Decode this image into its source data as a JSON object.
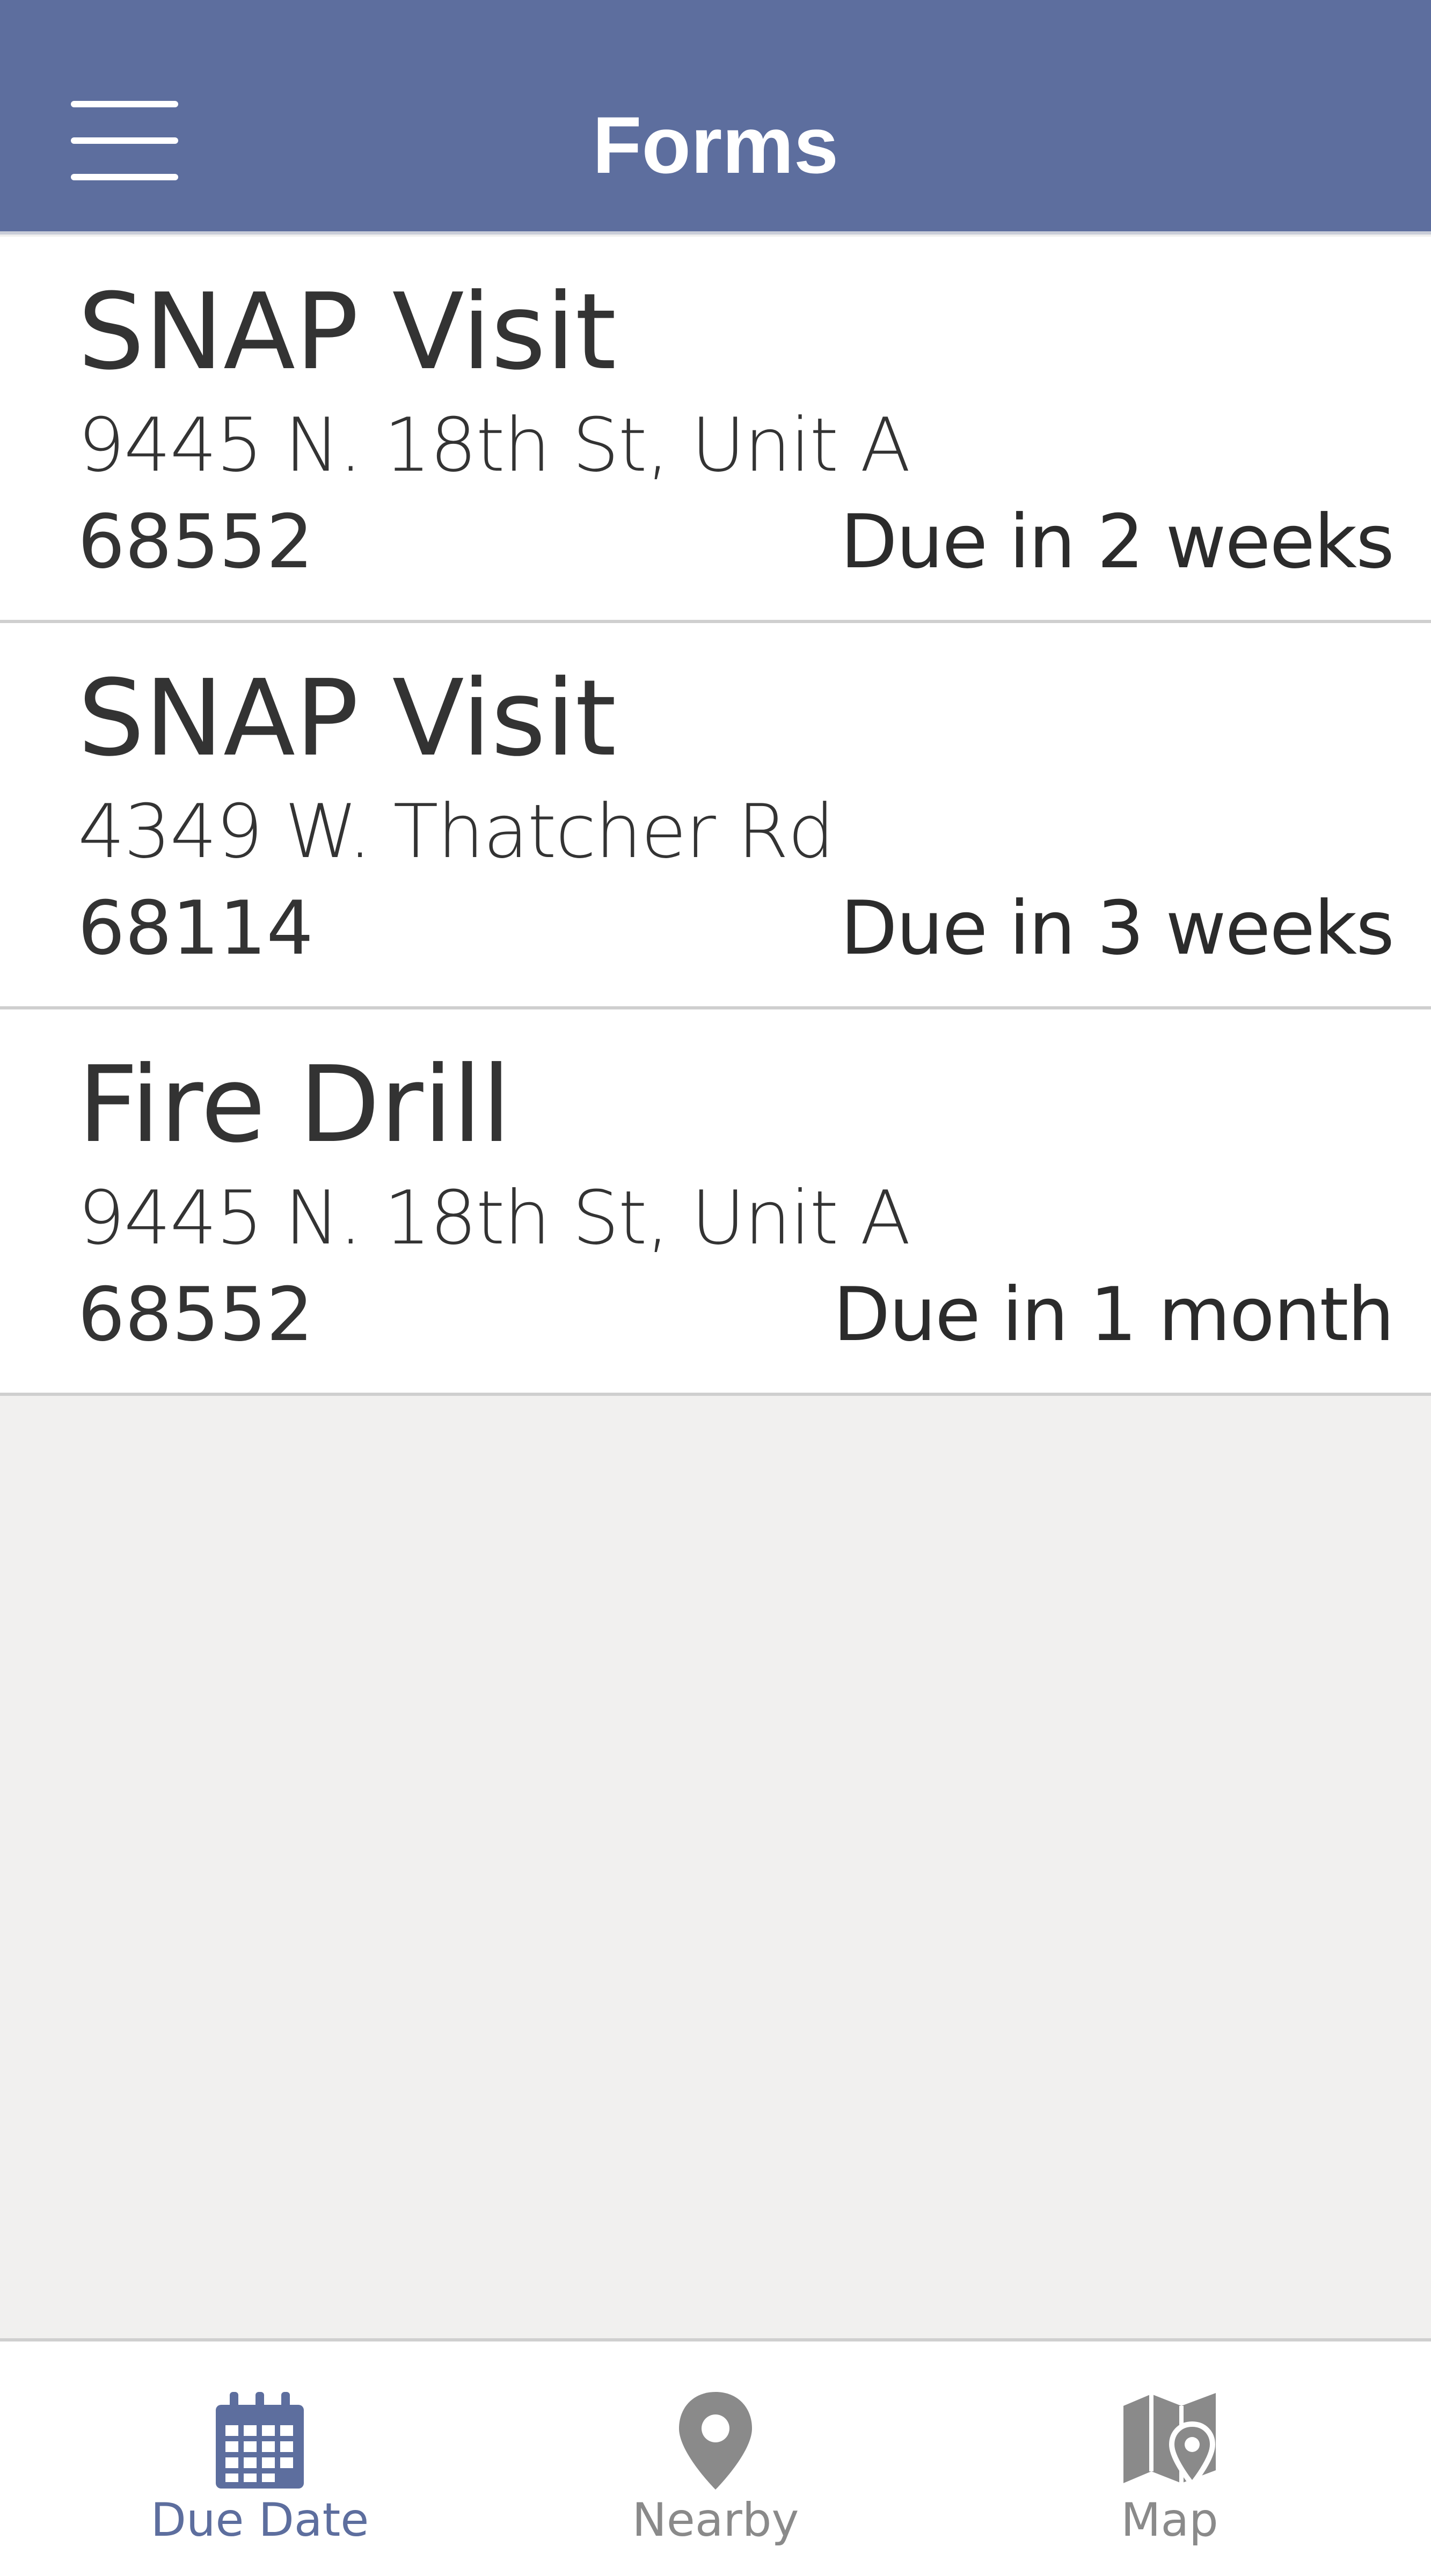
{
  "header": {
    "title": "Forms",
    "menu_icon": "hamburger-menu-icon"
  },
  "forms": [
    {
      "title": "SNAP Visit",
      "address": "9445 N. 18th St, Unit A",
      "zip": "68552",
      "due": "Due in 2 weeks"
    },
    {
      "title": "SNAP Visit",
      "address": "4349 W. Thatcher Rd",
      "zip": "68114",
      "due": "Due in 3 weeks"
    },
    {
      "title": "Fire Drill",
      "address": "9445 N. 18th St, Unit A",
      "zip": "68552",
      "due": "Due in 1 month"
    }
  ],
  "bottom_nav": {
    "active_tab": "Due Date",
    "tabs": [
      {
        "label": "Due Date",
        "icon": "calendar-icon"
      },
      {
        "label": "Nearby",
        "icon": "map-pin-icon"
      },
      {
        "label": "Map",
        "icon": "map-icon"
      }
    ]
  },
  "colors": {
    "header_bg": "#5d6e9e",
    "accent": "#5d6e9e",
    "inactive_nav": "#8a8a8a",
    "page_bg": "#f1f0ef",
    "text": "#333333"
  }
}
